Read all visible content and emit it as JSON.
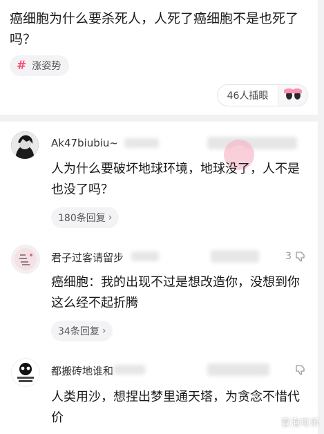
{
  "question": {
    "title": "癌细胞为什么要杀死人，人死了癌细胞不是也死了吗？",
    "tag_symbol": "#",
    "tag_label": "涨姿势",
    "interested_count": "46人插眼"
  },
  "comments": [
    {
      "author": "Ak47biubiu~",
      "text": "人为什么要破坏地球环境，地球没了，人不是也没了吗？",
      "replies_label": "180条回复",
      "likes": ""
    },
    {
      "author": "君子过客请留步",
      "text": "癌细胞：我的出现不过是想改造你，没想到你这么经不起折腾",
      "replies_label": "34条回复",
      "likes": "3"
    },
    {
      "author": "都搬砖地谁和",
      "text": "人类用沙，想捏出梦里通天塔，为贪念不惜代价",
      "replies_label": "",
      "likes": ""
    }
  ],
  "watermark": "冒泡可乐",
  "colors": {
    "tag_hash": "#ff4c73",
    "background": "#f2f2f4",
    "card": "#ffffff"
  }
}
